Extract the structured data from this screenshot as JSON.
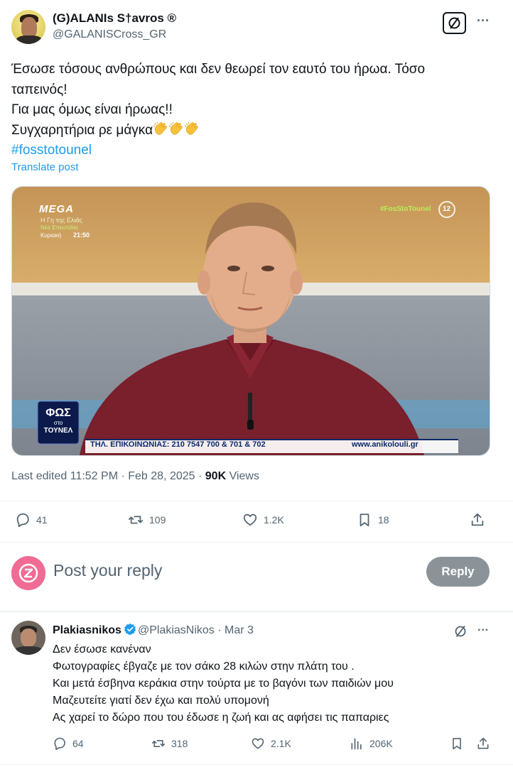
{
  "tweet": {
    "author_name": "(G)ALANIs S†avros ®",
    "author_handle": "@GALANISCross_GR",
    "text_lines": [
      "Έσωσε τόσους ανθρώπους και δεν θεωρεί τον εαυτό του ήρωα. Τόσο",
      "ταπεινός!",
      "Για μας όμως είναι ήρωας!!",
      "Συγχαρητήρια ρε μάγκα"
    ],
    "hashtag": "#fosstotounel",
    "translate_label": "Translate post",
    "media": {
      "channel_logo": "MEGA",
      "show_line1": "Η Γη της Ελιάς",
      "show_line2": "Νέα Επεισόδια",
      "show_day": "Κυριακή",
      "show_time": "21:50",
      "tv_hashtag": "#FosStoTounel",
      "rating": "12",
      "program_logo_line1": "ΦΩΣ",
      "program_logo_line2": "στο",
      "program_logo_line3": "ΤΟΥΝΕΛ",
      "ticker_phone": "ΤΗΛ. ΕΠΙΚΟΙΝΩΝΙΑΣ: 210 7547 700 & 701 & 702",
      "ticker_site": "www.anikolouli.gr"
    },
    "meta_prefix": "Last edited 11:52 PM · Feb 28, 2025 · ",
    "views_count": "90K",
    "views_label": " Views",
    "actions": {
      "replies": "41",
      "reposts": "109",
      "likes": "1.2K",
      "bookmarks": "18"
    }
  },
  "composer": {
    "avatar_letter": "Z",
    "placeholder": "Post your reply",
    "button_label": "Reply"
  },
  "reply": {
    "author_name": "Plakiasnikos",
    "author_handle": "@PlakiasNikos",
    "date": "Mar 3",
    "text_lines": [
      "Δεν έσωσε κανέναν",
      "Φωτογραφίες έβγαζε με τον σάκο 28 κιλών στην πλάτη του .",
      "Και μετά έσβηνα κεράκια στην τούρτα με το βαγόνι των παιδιών μου",
      "Μαζευτείτε γιατί δεν έχω και πολύ υπομονή",
      "Ας χαρεί το δώρο που του έδωσε η ζωή και ας αφήσει τις παπαριες"
    ],
    "actions": {
      "replies": "64",
      "reposts": "318",
      "likes": "2.1K",
      "views": "206K"
    }
  },
  "colors": {
    "link": "#1d9bf0",
    "secondary_text": "#536471",
    "primary_text": "#0f1419",
    "reply_button_bg": "#8b9399",
    "composer_avatar_bg": "#f06c95"
  },
  "icons": {
    "grok": "grok-icon",
    "more": "more-icon",
    "reply": "reply-icon",
    "repost": "repost-icon",
    "like": "heart-icon",
    "bookmark": "bookmark-icon",
    "share": "share-icon",
    "views": "views-icon",
    "verified": "verified-badge-icon",
    "clap": "clapping-hands-emoji"
  }
}
